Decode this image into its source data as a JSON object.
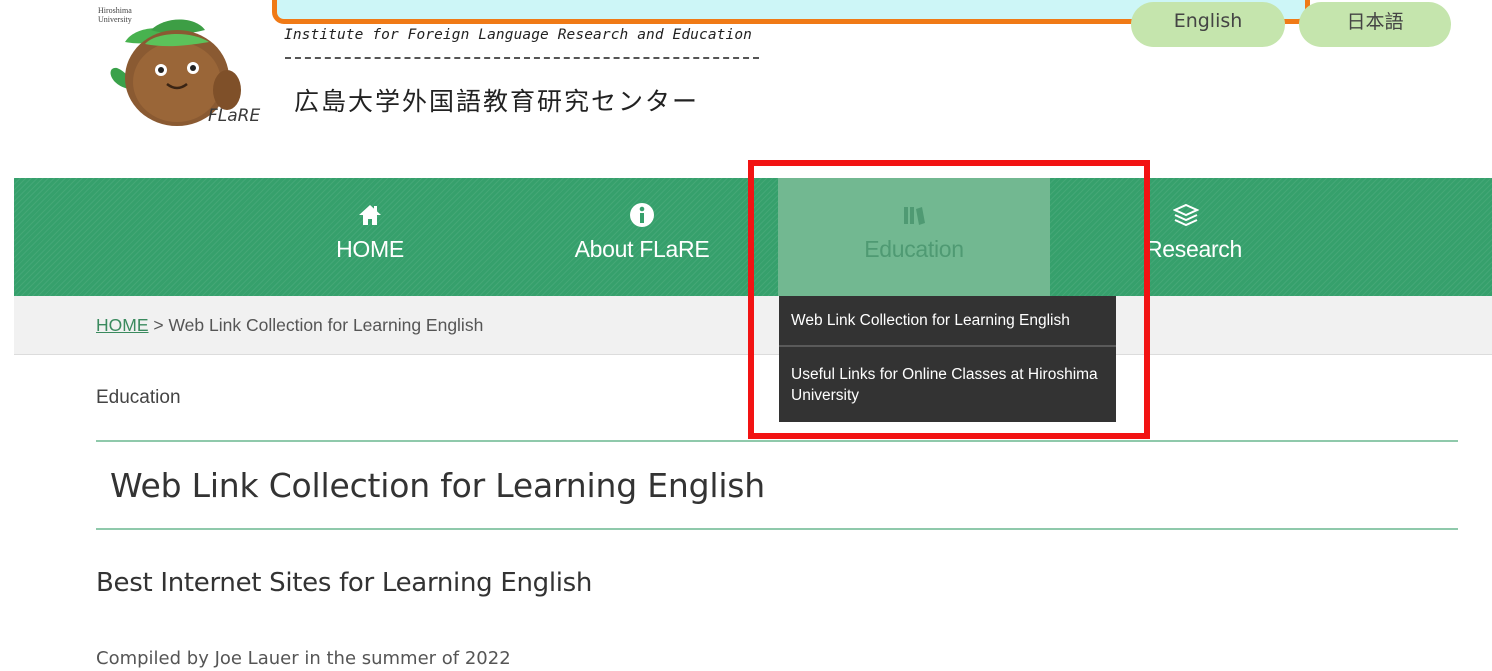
{
  "header": {
    "university_name": "Hiroshima University",
    "logo_text": "FLaRE",
    "institute_en": "Institute for Foreign Language Research and Education",
    "institute_ja": "広島大学外国語教育研究センター"
  },
  "language_switch": [
    {
      "label": "English"
    },
    {
      "label": "日本語"
    }
  ],
  "nav": {
    "items": [
      {
        "label": "HOME",
        "icon": "home-icon"
      },
      {
        "label": "About FLaRE",
        "icon": "info-icon"
      },
      {
        "label": "Education",
        "icon": "books-icon",
        "active": true
      },
      {
        "label": "Research",
        "icon": "layers-icon"
      }
    ]
  },
  "dropdown": {
    "items": [
      {
        "label": "Web Link Collection for Learning English"
      },
      {
        "label": "Useful Links for Online Classes at Hiroshima University"
      }
    ]
  },
  "breadcrumb": {
    "home": "HOME",
    "separator": " > ",
    "current": "Web Link Collection for Learning English"
  },
  "content": {
    "section_label": "Education",
    "title": "Web Link Collection for Learning English",
    "subheading": "Best Internet Sites for Learning English",
    "compiled": "Compiled by Joe Lauer in the summer of 2022"
  },
  "colors": {
    "nav_green": "#36a06c",
    "active_tab": "#72b891",
    "dropdown_bg": "#333333",
    "lang_button": "#c5e5ad",
    "highlight": "#f21313",
    "banner_border": "#f07a16",
    "banner_fill": "#cdf6f7"
  }
}
